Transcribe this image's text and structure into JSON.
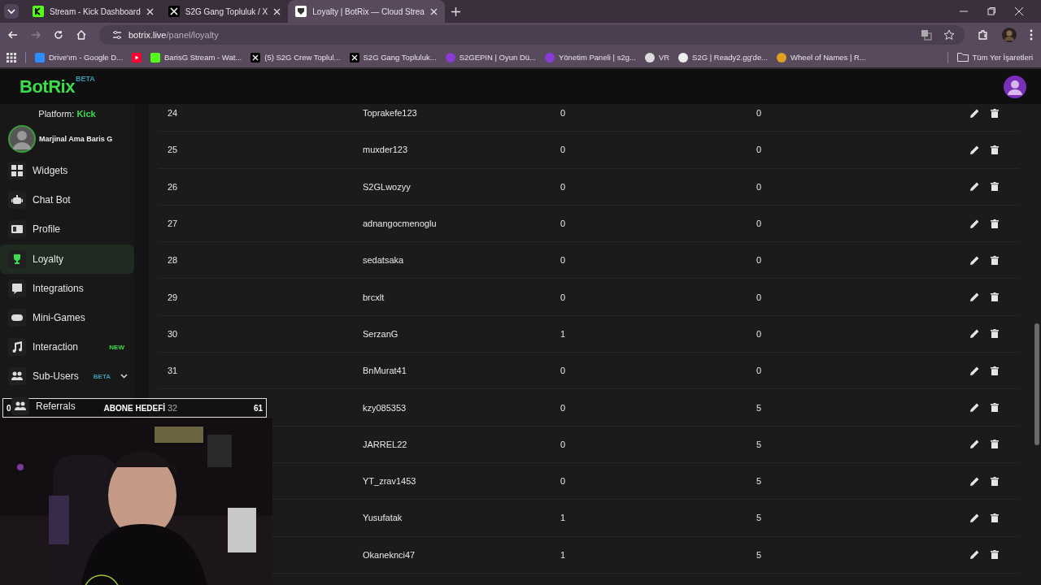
{
  "browser": {
    "tabs": [
      {
        "title": "Stream - Kick Dashboard",
        "kind": "kick",
        "selected": false
      },
      {
        "title": "S2G Gang Topluluk / X",
        "kind": "x",
        "selected": false
      },
      {
        "title": "Loyalty | BotRix — Cloud Strea",
        "kind": "shield",
        "selected": true
      }
    ],
    "address": {
      "host": "botrix.live",
      "path": "/panel/loyalty"
    },
    "bookmarks": [
      {
        "title": "Drive'ım - Google D...",
        "kind": "drive"
      },
      {
        "kind": "youtube"
      },
      {
        "title": "BarisG Stream - Wat...",
        "kind": "kick"
      },
      {
        "title": "(5) S2G Crew Toplul...",
        "kind": "x"
      },
      {
        "title": "S2G Gang Topluluk...",
        "kind": "x"
      },
      {
        "title": "S2GEPIN | Oyun Dü...",
        "kind": "badge"
      },
      {
        "title": "Yönetim Paneli | s2g...",
        "kind": "badge"
      },
      {
        "title": "VR",
        "kind": "ring"
      },
      {
        "title": "S2G | Ready2.gg'de...",
        "kind": "globe"
      },
      {
        "title": "Wheel of Names | R...",
        "kind": "wheel"
      }
    ],
    "all_bookmarks": "Tüm Yer İşaretleri"
  },
  "app": {
    "logo": "BotRix",
    "logo_badge": "BETA"
  },
  "sidebar": {
    "platform_label": "Platform:",
    "platform": "Kick",
    "user": "Marjinal Ama Baris G",
    "items": [
      {
        "label": "Widgets",
        "kind": "link",
        "selected": false
      },
      {
        "label": "Chat Bot",
        "kind": "link",
        "selected": false
      },
      {
        "label": "Profile",
        "kind": "link",
        "selected": false
      },
      {
        "label": "Loyalty",
        "kind": "link",
        "selected": true
      },
      {
        "label": "Integrations",
        "kind": "link",
        "selected": false
      },
      {
        "label": "Mini-Games",
        "kind": "link",
        "selected": false
      },
      {
        "label": "Interaction",
        "kind": "link",
        "selected": false,
        "badge": {
          "text": "NEW",
          "color": "#3ddc4b"
        }
      },
      {
        "label": "Sub-Users",
        "kind": "group",
        "selected": false,
        "badge": {
          "text": "BETA",
          "color": "#3a9ab0"
        }
      },
      {
        "label": "Referrals",
        "kind": "link",
        "selected": false
      }
    ]
  },
  "table": {
    "rows": [
      {
        "number": "24",
        "cells": [
          "Toprakefe123",
          "0",
          "0"
        ]
      },
      {
        "number": "25",
        "cells": [
          "muxder123",
          "0",
          "0"
        ]
      },
      {
        "number": "26",
        "cells": [
          "S2GLwozyy",
          "0",
          "0"
        ]
      },
      {
        "number": "27",
        "cells": [
          "adnangocmenoglu",
          "0",
          "0"
        ]
      },
      {
        "number": "28",
        "cells": [
          "sedatsaka",
          "0",
          "0"
        ]
      },
      {
        "number": "29",
        "cells": [
          "brcxlt",
          "0",
          "0"
        ]
      },
      {
        "number": "30",
        "cells": [
          "SerzanG",
          "1",
          "0"
        ]
      },
      {
        "number": "31",
        "cells": [
          "BnMurat41",
          "0",
          "0"
        ]
      },
      {
        "number": "32",
        "cells": [
          "kzy085353",
          "0",
          "5"
        ]
      },
      {
        "cells": [
          "JARREL22",
          "0",
          "5"
        ]
      },
      {
        "cells": [
          "YT_zrav1453",
          "0",
          "5"
        ]
      },
      {
        "cells": [
          "Yusufatak",
          "1",
          "5"
        ]
      },
      {
        "cells": [
          "Okaneknci47",
          "1",
          "5"
        ]
      }
    ]
  },
  "stream_overlay": {
    "goal": {
      "start": "0",
      "title": "ABONE HEDEFİ",
      "end": "61"
    }
  }
}
